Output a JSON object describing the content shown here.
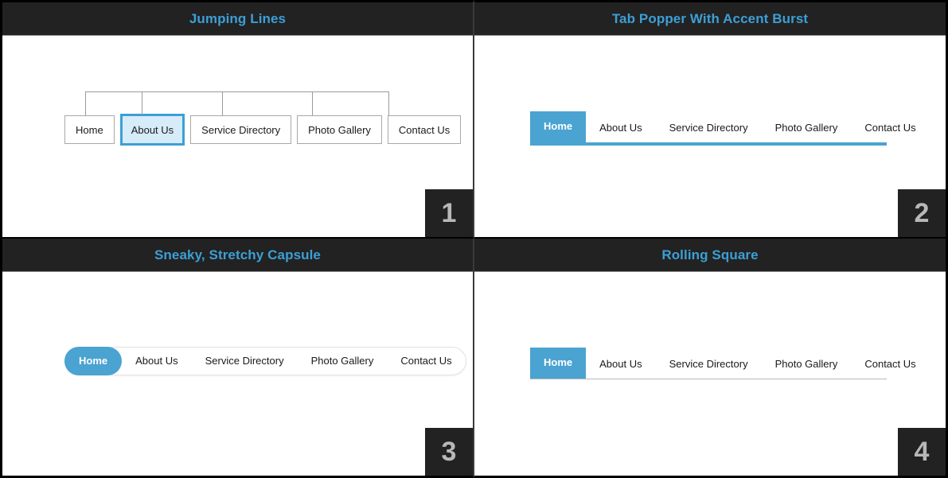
{
  "panels": [
    {
      "number": "1",
      "title": "Jumping Lines",
      "style": "connector-boxes",
      "active_index": 1,
      "items": [
        "Home",
        "About Us",
        "Service Directory",
        "Photo Gallery",
        "Contact Us"
      ]
    },
    {
      "number": "2",
      "title": "Tab Popper With Accent Burst",
      "style": "tabs-accent-underline",
      "active_index": 0,
      "items": [
        "Home",
        "About Us",
        "Service Directory",
        "Photo Gallery",
        "Contact Us"
      ]
    },
    {
      "number": "3",
      "title": "Sneaky, Stretchy Capsule",
      "style": "capsule-pill",
      "active_index": 0,
      "items": [
        "Home",
        "About Us",
        "Service Directory",
        "Photo Gallery",
        "Contact Us"
      ]
    },
    {
      "number": "4",
      "title": "Rolling Square",
      "style": "tabs-thin-underline",
      "active_index": 0,
      "items": [
        "Home",
        "About Us",
        "Service Directory",
        "Photo Gallery",
        "Contact Us"
      ]
    }
  ],
  "colors": {
    "title_bar_bg": "#222222",
    "title_text": "#3c9fd6",
    "accent": "#4aa3d1",
    "active_box_border": "#3c9fd6",
    "active_box_fill": "#d6ecf8",
    "box_border": "#a8a8a8",
    "connector_line": "#9a9a9a",
    "badge_bg": "#222222",
    "badge_text": "#b8b8b8",
    "panel_bg": "#ffffff",
    "page_bg": "#000000"
  }
}
